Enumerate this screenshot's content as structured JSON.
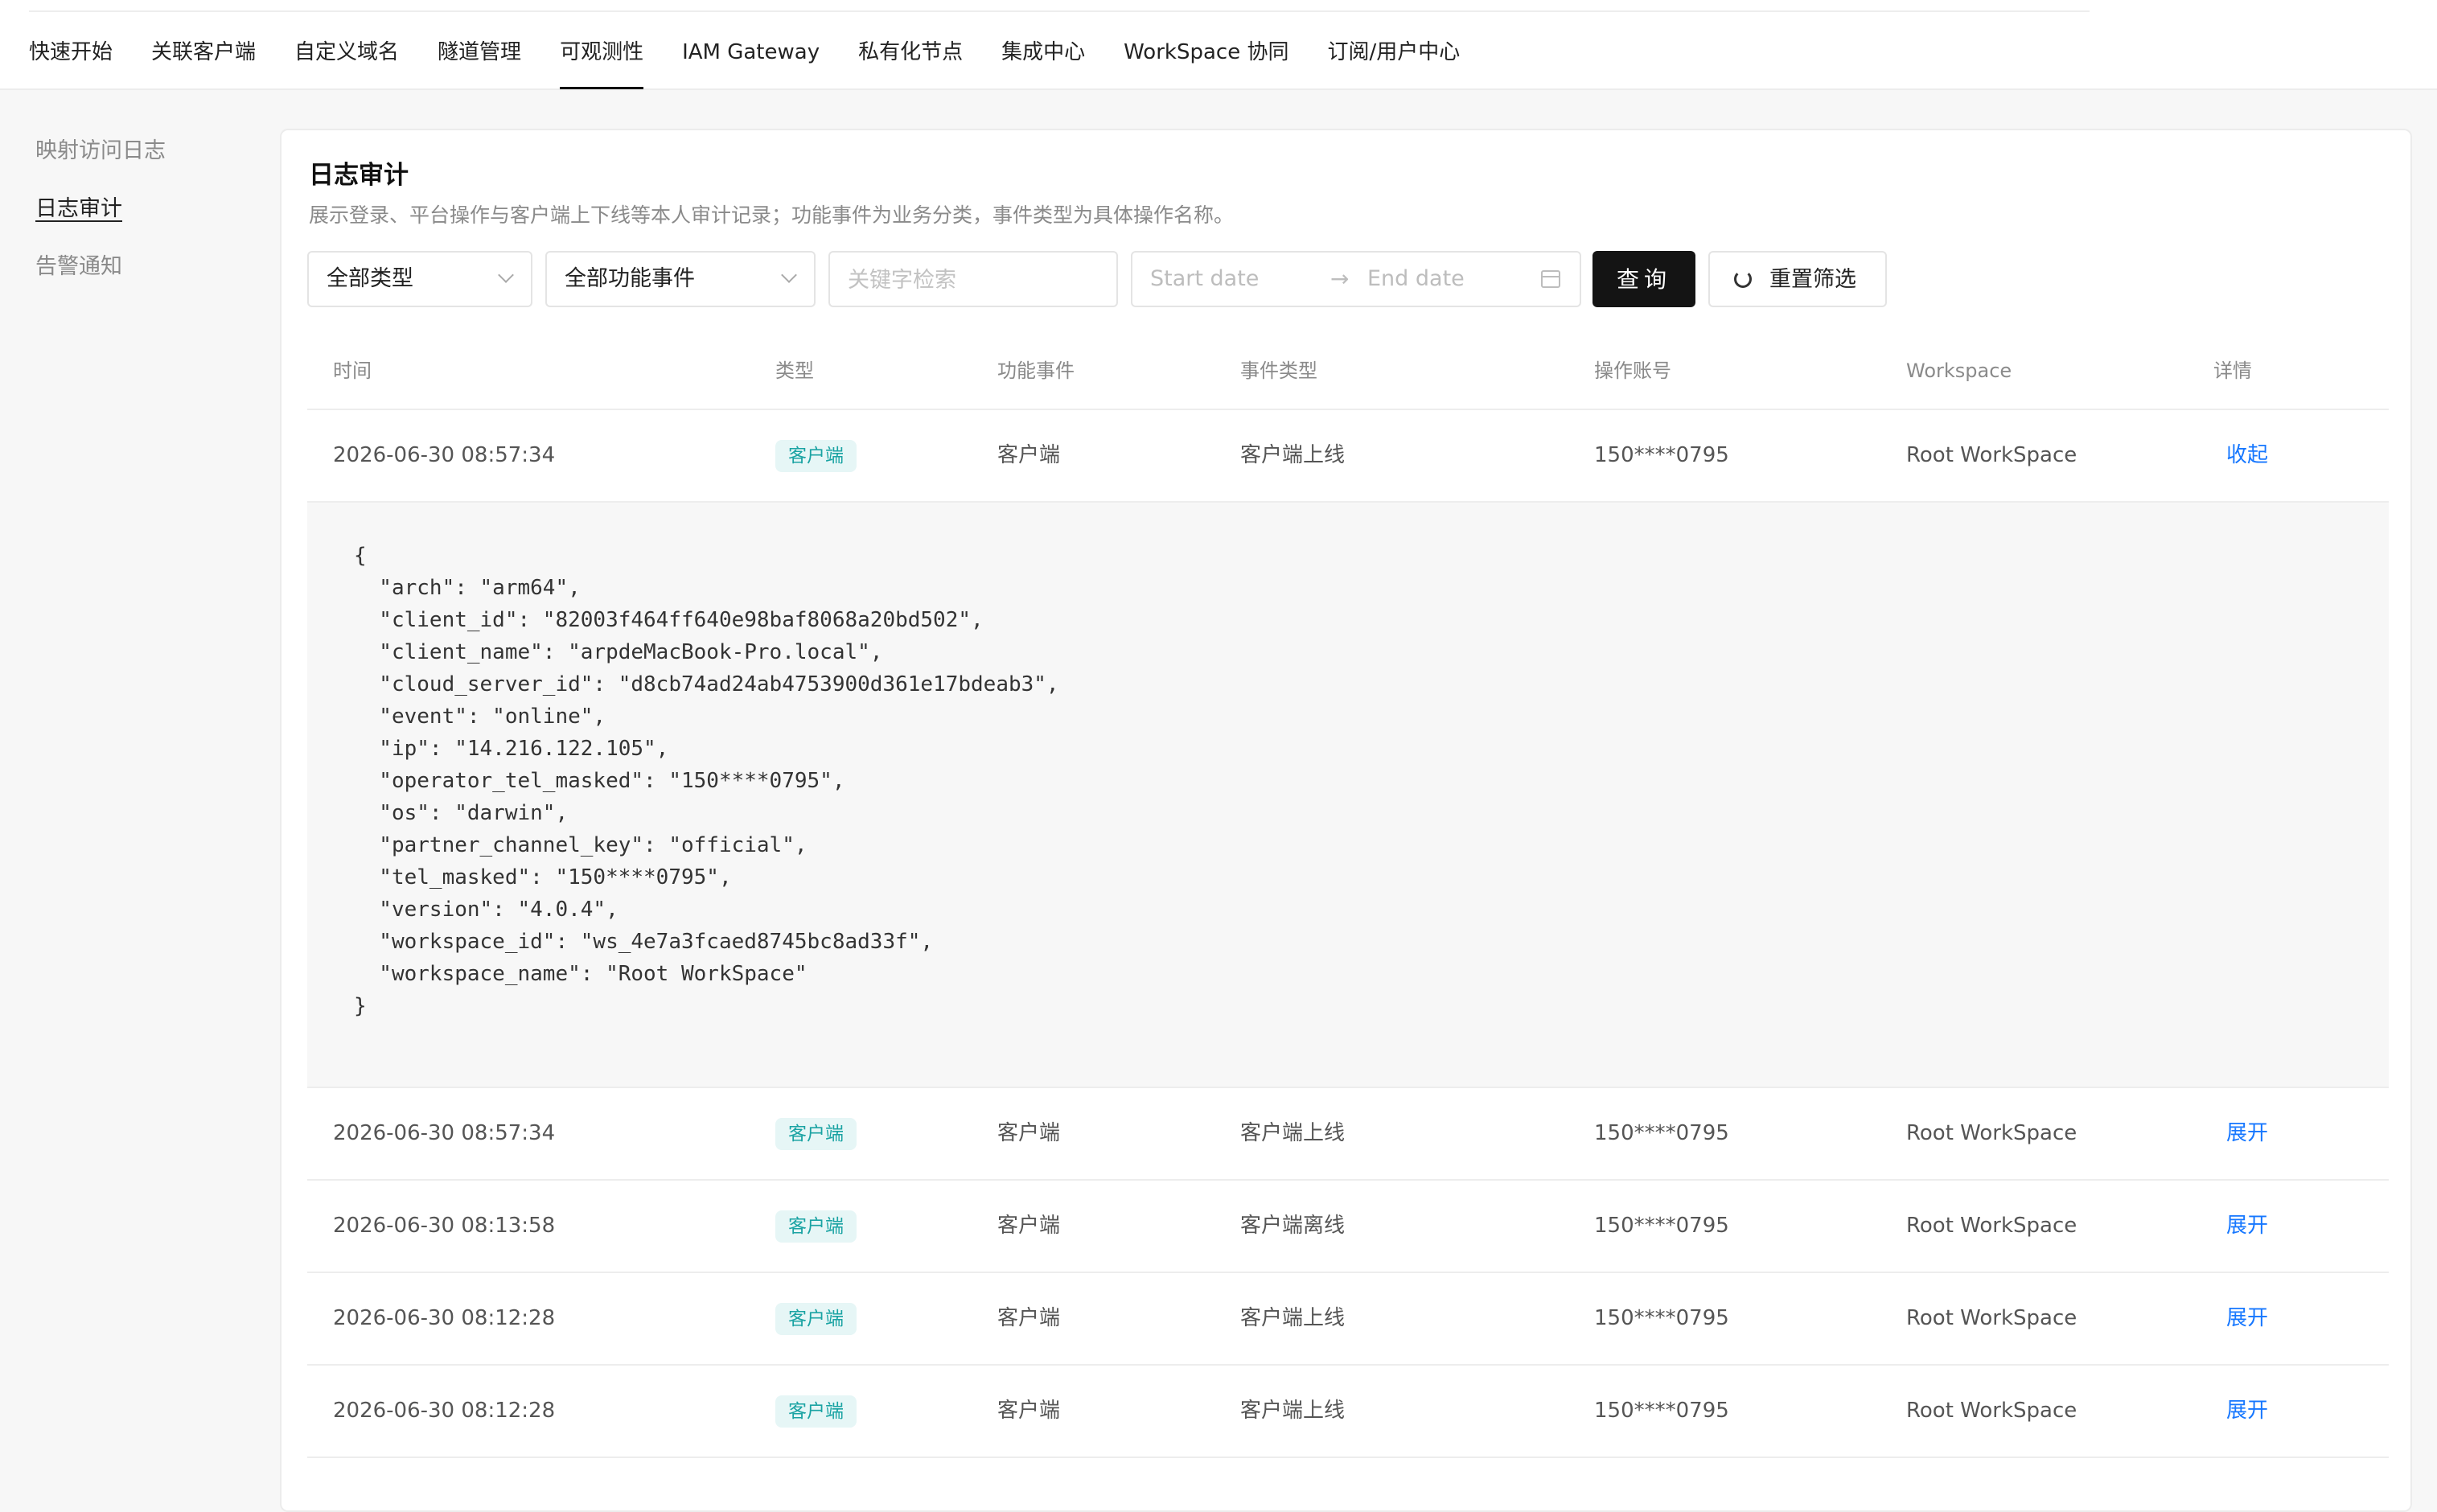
{
  "nav": {
    "tabs": [
      {
        "label": "快速开始"
      },
      {
        "label": "关联客户端"
      },
      {
        "label": "自定义域名"
      },
      {
        "label": "隧道管理"
      },
      {
        "label": "可观测性",
        "active": true
      },
      {
        "label": "IAM Gateway"
      },
      {
        "label": "私有化节点"
      },
      {
        "label": "集成中心"
      },
      {
        "label": "WorkSpace 协同"
      },
      {
        "label": "订阅/用户中心"
      }
    ]
  },
  "sidebar": {
    "items": [
      {
        "label": "映射访问日志"
      },
      {
        "label": "日志审计",
        "active": true
      },
      {
        "label": "告警通知"
      }
    ]
  },
  "main": {
    "title": "日志审计",
    "description": "展示登录、平台操作与客户端上下线等本人审计记录；功能事件为业务分类，事件类型为具体操作名称。"
  },
  "filters": {
    "type_select": "全部类型",
    "event_select": "全部功能事件",
    "search_placeholder": "关键字检索",
    "start_placeholder": "Start date",
    "end_placeholder": "End date",
    "range_arrow": "→",
    "query_label": "查询",
    "reset_label": "重置筛选"
  },
  "table": {
    "headers": {
      "time": "时间",
      "type": "类型",
      "func": "功能事件",
      "event": "事件类型",
      "account": "操作账号",
      "workspace": "Workspace",
      "detail": "详情"
    },
    "rows": [
      {
        "time": "2026-06-30 08:57:34",
        "type": "客户端",
        "func": "客户端",
        "event": "客户端上线",
        "account": "150****0795",
        "workspace": "Root WorkSpace",
        "action": "收起"
      },
      {
        "time": "2026-06-30 08:57:34",
        "type": "客户端",
        "func": "客户端",
        "event": "客户端上线",
        "account": "150****0795",
        "workspace": "Root WorkSpace",
        "action": "展开"
      },
      {
        "time": "2026-06-30 08:13:58",
        "type": "客户端",
        "func": "客户端",
        "event": "客户端离线",
        "account": "150****0795",
        "workspace": "Root WorkSpace",
        "action": "展开"
      },
      {
        "time": "2026-06-30 08:12:28",
        "type": "客户端",
        "func": "客户端",
        "event": "客户端上线",
        "account": "150****0795",
        "workspace": "Root WorkSpace",
        "action": "展开"
      },
      {
        "time": "2026-06-30 08:12:28",
        "type": "客户端",
        "func": "客户端",
        "event": "客户端上线",
        "account": "150****0795",
        "workspace": "Root WorkSpace",
        "action": "展开"
      }
    ],
    "expanded_detail": "{\n  \"arch\": \"arm64\",\n  \"client_id\": \"82003f464ff640e98baf8068a20bd502\",\n  \"client_name\": \"arpdeMacBook-Pro.local\",\n  \"cloud_server_id\": \"d8cb74ad24ab4753900d361e17bdeab3\",\n  \"event\": \"online\",\n  \"ip\": \"14.216.122.105\",\n  \"operator_tel_masked\": \"150****0795\",\n  \"os\": \"darwin\",\n  \"partner_channel_key\": \"official\",\n  \"tel_masked\": \"150****0795\",\n  \"version\": \"4.0.4\",\n  \"workspace_id\": \"ws_4e7a3fcaed8745bc8ad33f\",\n  \"workspace_name\": \"Root WorkSpace\"\n}"
  }
}
